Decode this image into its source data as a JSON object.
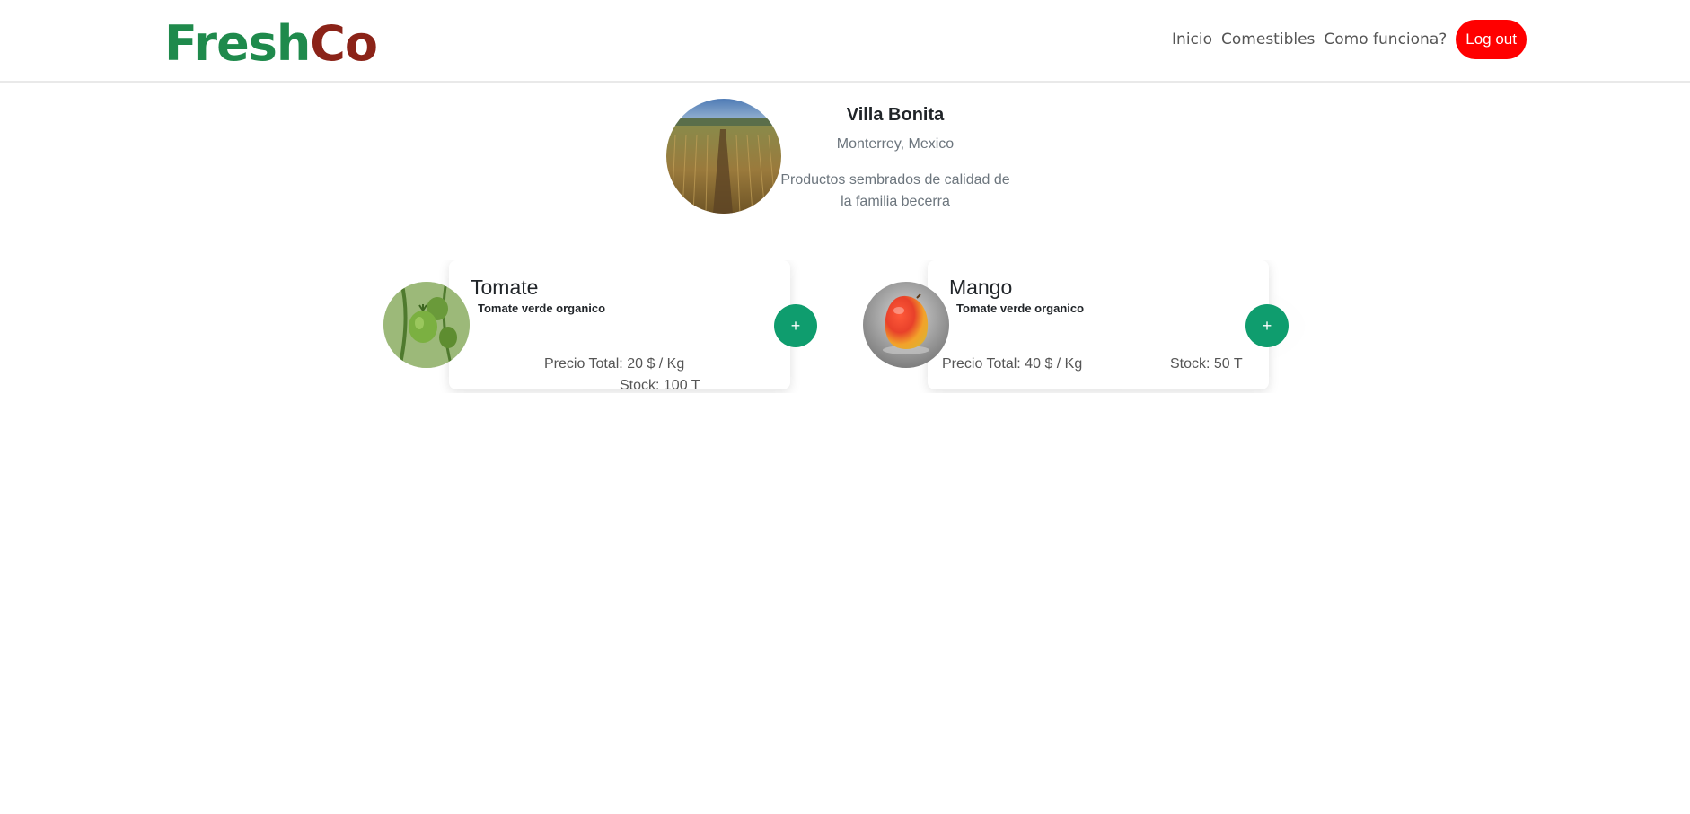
{
  "header": {
    "logo_part1": "Fresh",
    "logo_part2": "Co",
    "nav": [
      "Inicio",
      "Comestibles",
      "Como funciona?"
    ],
    "logout_label": "Log out"
  },
  "farm": {
    "name": "Villa Bonita",
    "location": "Monterrey, Mexico",
    "description": "Productos sembrados de calidad de la familia becerra",
    "photo_icon": "field-photo"
  },
  "products": [
    {
      "name": "Tomate",
      "description": "Tomate verde organico",
      "price": "Precio Total: 20 $ / Kg",
      "stock": "Stock: 100 T",
      "add_label": "+",
      "image_icon": "green-tomato-photo"
    },
    {
      "name": "Mango",
      "description": "Tomate verde organico",
      "price": "Precio Total: 40 $ / Kg",
      "stock": "Stock: 50 T",
      "add_label": "+",
      "image_icon": "mango-photo"
    }
  ],
  "colors": {
    "logo_green": "#1f8a4c",
    "logo_red": "#8b2318",
    "logout_bg": "#ff0000",
    "add_button": "#0f9d6e"
  }
}
